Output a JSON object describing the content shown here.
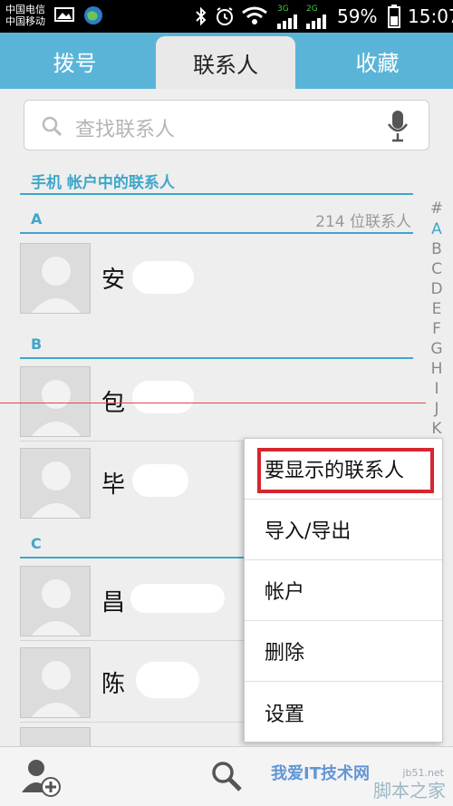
{
  "status_bar": {
    "carrier_1": "中国电信",
    "carrier_2": "中国移动",
    "net_3g": "3G",
    "net_2g": "2G",
    "battery": "59%",
    "time": "15:07"
  },
  "tabs": [
    {
      "label": "拨号"
    },
    {
      "label": "联系人"
    },
    {
      "label": "收藏"
    }
  ],
  "search": {
    "placeholder": "查找联系人"
  },
  "account_header": "手机 帐户中的联系人",
  "contact_count": "214 位联系人",
  "sections": [
    {
      "letter": "A"
    },
    {
      "letter": "B"
    },
    {
      "letter": "C"
    }
  ],
  "contacts": [
    {
      "name": "安"
    },
    {
      "name": "包"
    },
    {
      "name": "毕"
    },
    {
      "name": "昌"
    },
    {
      "name": "陈"
    }
  ],
  "index_letters": [
    "#",
    "A",
    "B",
    "C",
    "D",
    "E",
    "F",
    "G",
    "H",
    "I",
    "J",
    "K"
  ],
  "menu": {
    "items": [
      {
        "label": "要显示的联系人"
      },
      {
        "label": "导入/导出"
      },
      {
        "label": "帐户"
      },
      {
        "label": "删除"
      },
      {
        "label": "设置"
      }
    ]
  },
  "watermark": {
    "main": "脚本之家",
    "small": "jb51.net",
    "blue": "我爱IT技术网"
  },
  "colors": {
    "accent": "#3fa6c9",
    "tab_bar": "#5ab4d8",
    "highlight": "#d7262f"
  }
}
